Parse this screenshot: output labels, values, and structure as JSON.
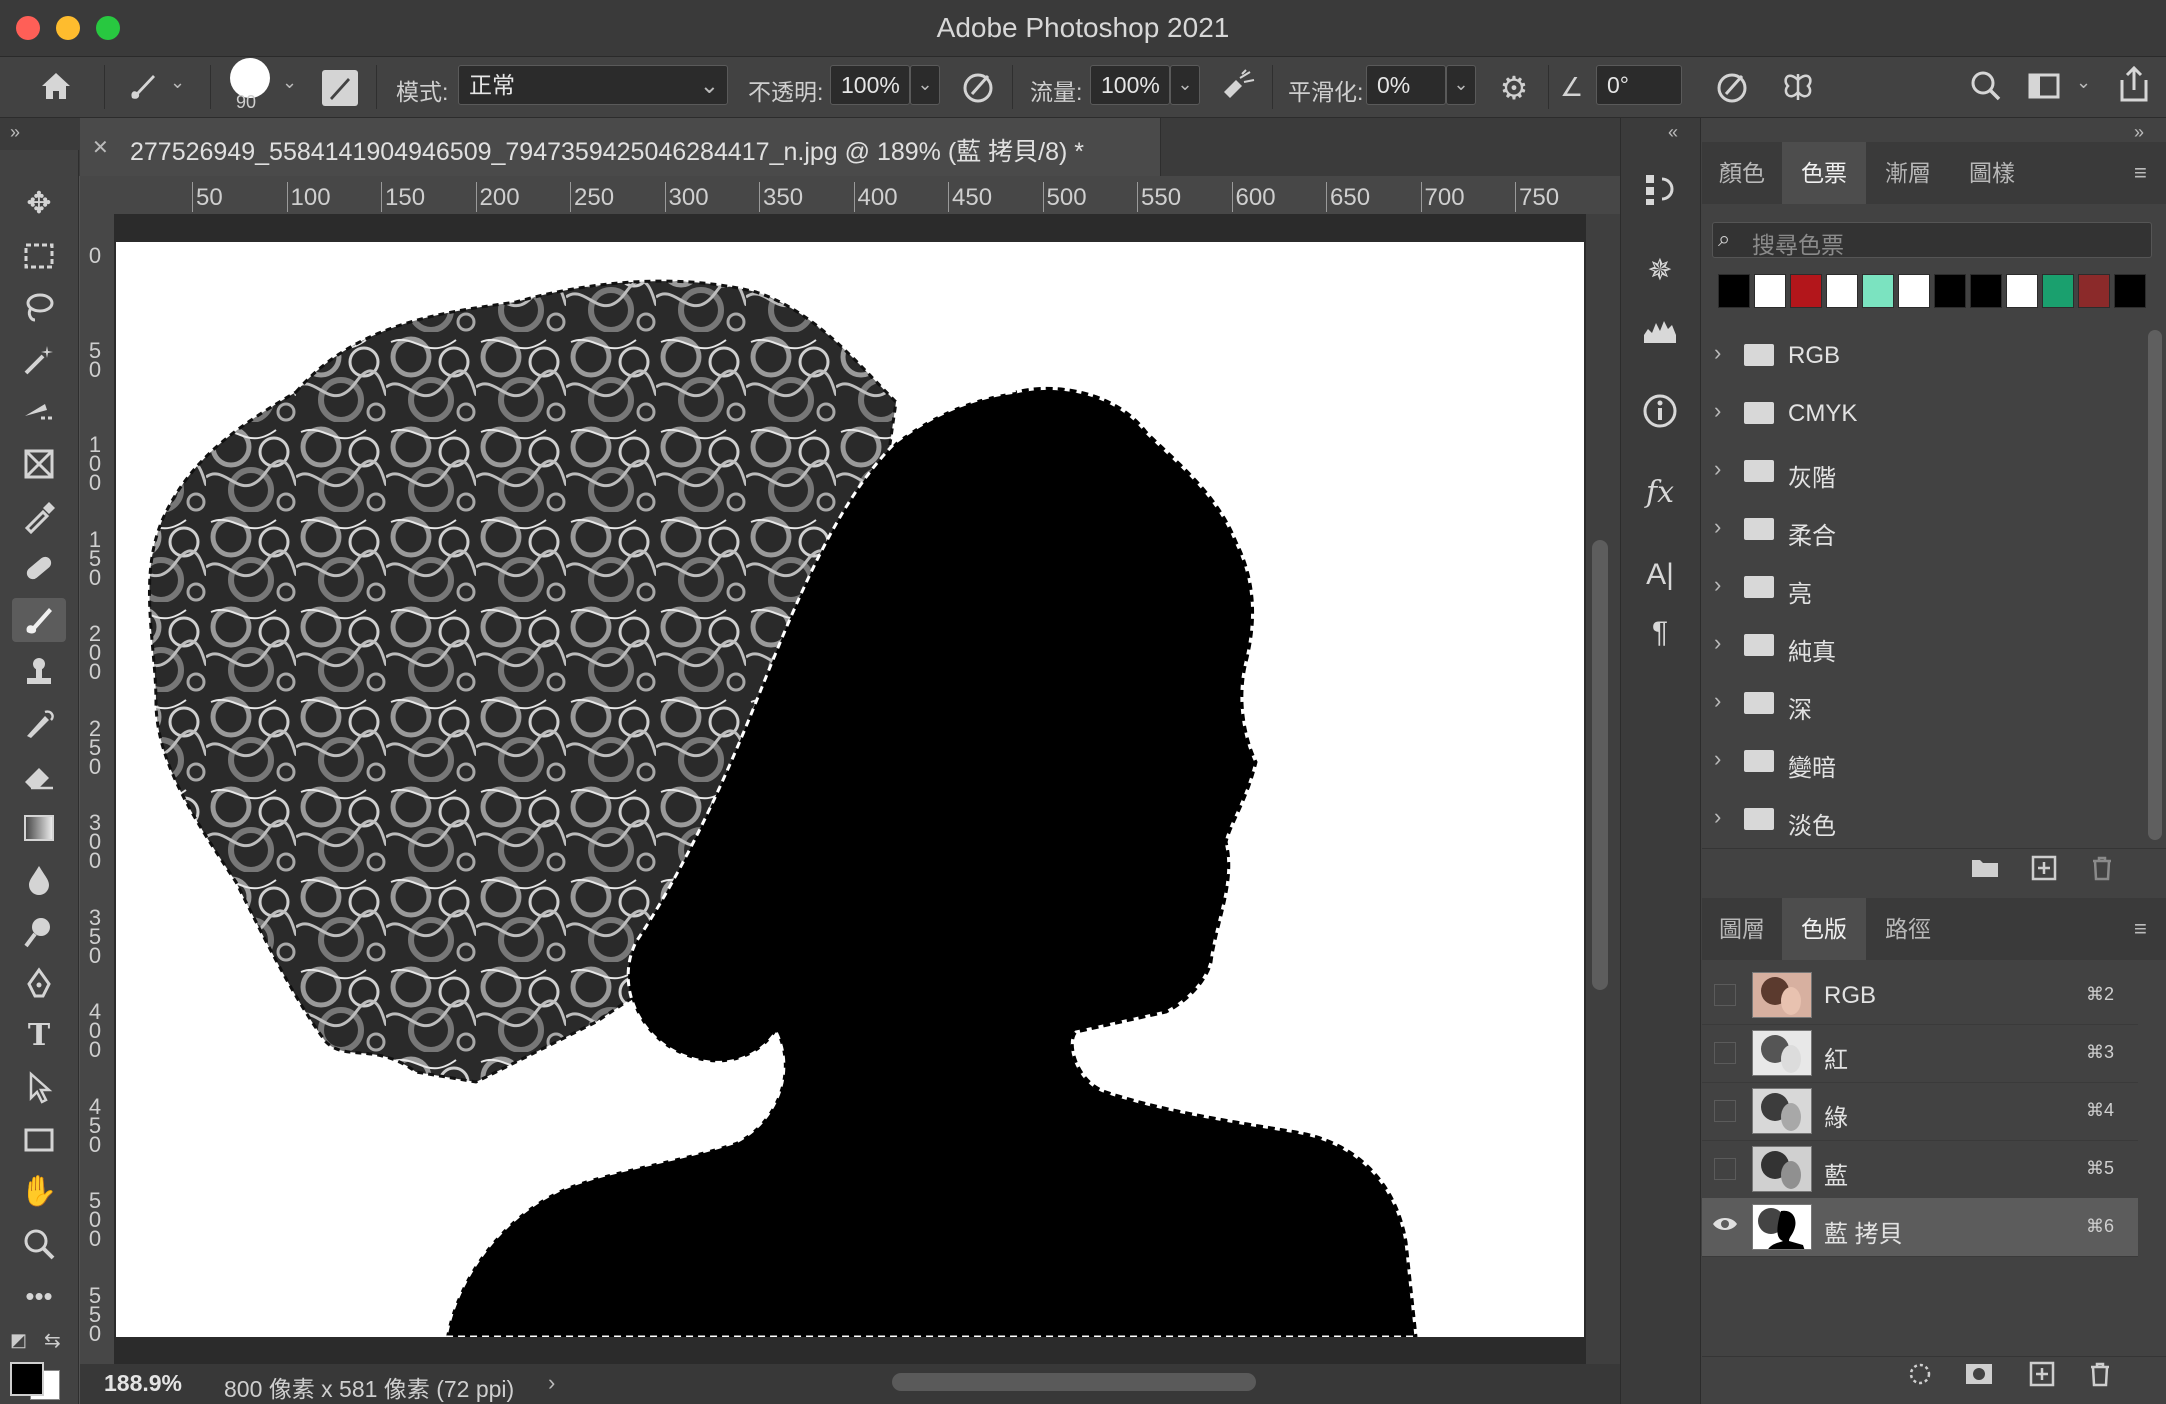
{
  "window": {
    "title": "Adobe Photoshop 2021"
  },
  "options": {
    "brush_size": "90",
    "mode_label": "模式:",
    "mode_value": "正常",
    "opacity_label": "不透明:",
    "opacity_value": "100%",
    "flow_label": "流量:",
    "flow_value": "100%",
    "smoothing_label": "平滑化:",
    "smoothing_value": "0%",
    "angle_value": "0°"
  },
  "document": {
    "tab_title": "277526949_5584141904946509_7947359425046284417_n.jpg @ 189% (藍 拷貝/8) *",
    "zoom": "188.9%",
    "size": "800 像素 x 581 像素 (72 ppi)"
  },
  "rulers": {
    "h_ticks": [
      "50",
      "100",
      "150",
      "200",
      "250",
      "300",
      "350",
      "400",
      "450",
      "500",
      "550",
      "600",
      "650",
      "700",
      "750"
    ],
    "v_ticks": [
      "0",
      "50",
      "100",
      "150",
      "200",
      "250",
      "300",
      "350",
      "400",
      "450",
      "500",
      "550"
    ]
  },
  "swatches_panel": {
    "tabs": [
      "顏色",
      "色票",
      "漸層",
      "圖樣"
    ],
    "active_tab": "色票",
    "search_placeholder": "搜尋色票",
    "colors": [
      "#000000",
      "#ffffff",
      "#b3161b",
      "#ffffff",
      "#7be3c0",
      "#ffffff",
      "#000000",
      "#000000",
      "#ffffff",
      "#1aa06e",
      "#8b2a2a",
      "#000000"
    ],
    "groups": [
      "RGB",
      "CMYK",
      "灰階",
      "柔合",
      "亮",
      "純真",
      "深",
      "變暗",
      "淡色"
    ]
  },
  "channels_panel": {
    "tabs": [
      "圖層",
      "色版",
      "路徑"
    ],
    "active_tab": "色版",
    "channels": [
      {
        "name": "RGB",
        "key": "⌘2"
      },
      {
        "name": "紅",
        "key": "⌘3"
      },
      {
        "name": "綠",
        "key": "⌘4"
      },
      {
        "name": "藍",
        "key": "⌘5"
      },
      {
        "name": "藍 拷貝",
        "key": "⌘6"
      }
    ]
  },
  "colors": {
    "foreground": "#000000",
    "background": "#ffffff"
  }
}
